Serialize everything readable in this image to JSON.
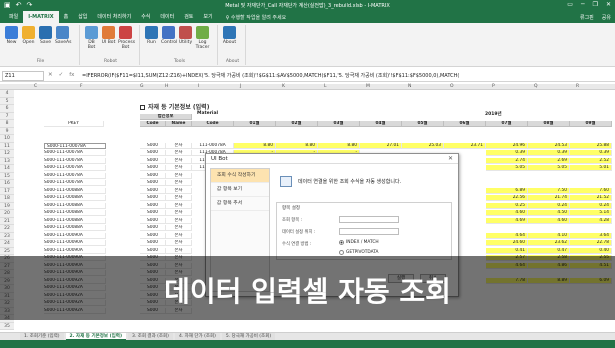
{
  "window": {
    "title": "Metal 및 자재단가_Call 자재단가 계산(실전밥)_3_rebuild.xlsb - I-MATRIX",
    "qat_icons": [
      "save-icon",
      "undo-icon",
      "redo-icon"
    ],
    "controls": [
      "ribbon-options-icon",
      "minimize-icon",
      "restore-icon",
      "close-icon"
    ]
  },
  "ribbon_tabs": [
    "파일",
    "I-MATRIX",
    "홈",
    "삽입",
    "데이터 처리하기",
    "수식",
    "데이터",
    "검토",
    "보기"
  ],
  "tell_me": "♀ 수행할 작업을 알려 주세요",
  "user": {
    "name": "류그핀",
    "share": "공유"
  },
  "ribbon_groups": [
    {
      "name": "File",
      "buttons": [
        "New",
        "Open",
        "Save",
        "SaveAs"
      ]
    },
    {
      "name": "Robot",
      "buttons": [
        "DB Bot",
        "UI Bot",
        "Process Bot"
      ]
    },
    {
      "name": "Tools",
      "buttons": [
        "Run",
        "Control",
        "Utility",
        "Log Tracer"
      ]
    },
    {
      "name": "About",
      "buttons": [
        "About"
      ]
    }
  ],
  "formula_bar": {
    "name_box": "Z11",
    "formula": "=IFERROR(IF($F11=$I11,SUM(Z12:Z16)+INDEX('5. 당극재 가공비 (조회)'!$G$11:$AV$5000,MATCH($F11,'5. 당극재 가공비 (조회)'!$F$11:$F$5000,0),MATCH("
  },
  "columns": [
    "C",
    "F",
    "G",
    "H",
    "I",
    "J",
    "K",
    "L",
    "M",
    "N",
    "O",
    "P",
    "Q",
    "R",
    "S",
    "T",
    "U",
    "V",
    "W",
    "X",
    "Y",
    "Z",
    "AA"
  ],
  "rows": [
    "4",
    "5",
    "6",
    "7",
    "8",
    "9",
    "10",
    "11",
    "12",
    "13",
    "14",
    "15",
    "16",
    "17",
    "18",
    "19",
    "20",
    "21",
    "22",
    "23",
    "24",
    "25",
    "26",
    "27",
    "28",
    "29",
    "30",
    "31",
    "32",
    "33",
    "34",
    "35"
  ],
  "sheet": {
    "title": "자재 등 기본정보 (입력)",
    "material_label": "Material",
    "year_label": "2019년",
    "headers": {
      "part": "PKEY",
      "biz": "법인정보",
      "code": "Code",
      "name": "Name",
      "mcode": "Code",
      "months": [
        "01월",
        "02월",
        "03월",
        "04월",
        "05월",
        "06월",
        "07월",
        "08월",
        "09월",
        "10월"
      ]
    },
    "part_codes": [
      "S000-111-00078A",
      "S000-111-00078A",
      "S000-111-00078A",
      "S000-111-00078A",
      "S000-111-00078A",
      "S000-111-00078A",
      "S000-111-00088A",
      "S000-111-00088A",
      "S000-111-00088A",
      "S000-111-00088A",
      "S000-111-00088A",
      "S000-111-00088A",
      "S000-111-00090A",
      "S000-111-00090A",
      "S000-111-00090A",
      "S000-111-00090A",
      "S000-111-00090A",
      "S000-111-00090A",
      "S000-111-00092A",
      "S000-111-00092A",
      "S000-111-00092A",
      "S000-111-00092A",
      "S000-111-00092A"
    ],
    "biz_code": "S000",
    "biz_name": "본사",
    "material_code": "111-00078A",
    "material_codes": [
      "111-00078A",
      "111-00078A",
      "111-00078A",
      "111-00078A"
    ],
    "row11_values": [
      "8.80",
      "8.80",
      "8.80",
      "27.01",
      "25.03",
      "23.71",
      "24.96",
      "24.53",
      "25.88"
    ],
    "right_values": [
      [
        "0.39",
        "0.39",
        "0.39"
      ],
      [
        "2.74",
        "2.69",
        "2.52"
      ],
      [
        "5.05",
        "5.05",
        "5.01"
      ],
      [
        "6.89",
        "7.50",
        "7.60"
      ],
      [
        "22.56",
        "21.74",
        "21.52"
      ],
      [
        "0.25",
        "0.24",
        "0.24"
      ],
      [
        "4.60",
        "4.50",
        "5.14"
      ],
      [
        "4.69",
        "4.60",
        "4.28"
      ],
      [
        "4.64",
        "4.10",
        "3.64"
      ],
      [
        "24.60",
        "23.62",
        "22.78"
      ],
      [
        "0.41",
        "0.47",
        "0.40"
      ],
      [
        "2.57",
        "2.58",
        "2.55"
      ],
      [
        "4.64",
        "4.86",
        "4.51"
      ],
      [
        "7.78",
        "8.89",
        "6.09"
      ]
    ],
    "dash": "-"
  },
  "dialog": {
    "title": "UI Bot",
    "close": "✕",
    "menu": [
      "조회 수식 작성하기",
      "값 항목 보기",
      "값 항목 추서"
    ],
    "description": "데이터 연결을 위한 조회 수식을 자동 생성합니다.",
    "section_label": "항목 설정",
    "field1_label": "조회 항목 :",
    "field2_label": "데이터 설정 위치 :",
    "method_label": "수식 연결 방법 :",
    "option1": "INDEX / MATCH",
    "option2": "GETPIVOTDATA",
    "ok": "실행",
    "cancel": "취소"
  },
  "sheet_tabs": [
    "1. 조회기준 (입력)",
    "2. 자재 등 기본정보 (입력)",
    "3. 조회 결과 (조회)",
    "4. 자재 단가 (조회)",
    "5. 당극재 가공비 (조회)"
  ],
  "caption": "데이터 입력셀 자동 조회",
  "colors": {
    "excel_green": "#217346",
    "yellow": "#ffff66",
    "header_gray": "#d9d9d9"
  }
}
